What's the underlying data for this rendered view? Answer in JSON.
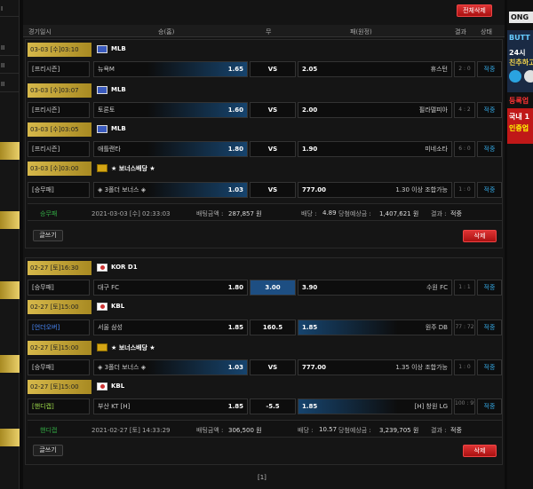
{
  "left_nav": [
    "I",
    "II",
    "II",
    "II"
  ],
  "right_ad": {
    "logo": "ONG",
    "button": "BUTT",
    "text1": "24시",
    "text2": "친추하고",
    "register": "등록업",
    "red1": "국내 1",
    "red2": "인증업"
  },
  "header": {
    "delete_all": "전체삭제",
    "cols": {
      "datetime": "경기일시",
      "home": "승(홈)",
      "draw": "무",
      "away": "패(원정)",
      "result": "결과",
      "status": "상태"
    }
  },
  "bet_groups": [
    {
      "matches": [
        {
          "date": "03-03 [수]03:10",
          "league": "MLB",
          "flag": "us",
          "type": "[프리시즌]",
          "home": "뉴욕M",
          "home_odds": "1.65",
          "mid": "VS",
          "away_odds": "2.05",
          "away": "휴스턴",
          "score": "2 : 0",
          "status": "적중",
          "sel": "home"
        },
        {
          "date": "03-03 [수]03:07",
          "league": "MLB",
          "flag": "us",
          "type": "[프리시즌]",
          "home": "토론토",
          "home_odds": "1.60",
          "mid": "VS",
          "away_odds": "2.00",
          "away": "필라델피아",
          "score": "4 : 2",
          "status": "적중",
          "sel": "home"
        },
        {
          "date": "03-03 [수]03:05",
          "league": "MLB",
          "flag": "us",
          "type": "[프리시즌]",
          "home": "애틀랜타",
          "home_odds": "1.80",
          "mid": "VS",
          "away_odds": "1.90",
          "away": "미네소타",
          "score": "6 : 0",
          "status": "적중",
          "sel": "home"
        },
        {
          "date": "03-03 [수]03:00",
          "league": "★ 보너스배당 ★",
          "flag": "bonus",
          "type": "[승무패]",
          "home": "◈ 3폴더 보너스 ◈",
          "home_odds": "1.03",
          "mid": "VS",
          "away_odds": "777.00",
          "away": "1.30 이상 조합가능",
          "score": "1 : 0",
          "status": "적중",
          "sel": "home"
        }
      ],
      "summary": {
        "bet_type": "승무패",
        "datetime": "2021-03-03 [수] 02:33:03",
        "bet_amount_label": "배팅금액 :",
        "bet_amount": "287,857 원",
        "odds_label": "배당 :",
        "odds": "4.89",
        "expected_label": "당첨예상금 :",
        "expected": "1,407,621 원",
        "result_label": "결과 :",
        "result": "적중"
      },
      "write_label": "글쓰기",
      "delete_label": "삭제"
    },
    {
      "matches": [
        {
          "date": "02-27 [토]16:30",
          "league": "KOR D1",
          "flag": "kr",
          "type": "[승무패]",
          "home": "대구 FC",
          "home_odds": "1.80",
          "mid": "3.00",
          "away_odds": "3.90",
          "away": "수원 FC",
          "score": "1 : 1",
          "status": "적중",
          "sel": "mid"
        },
        {
          "date": "02-27 [토]15:00",
          "league": "KBL",
          "flag": "kr",
          "type": "[언더오버]",
          "home": "서울 삼성",
          "home_odds": "1.85",
          "mid": "160.5",
          "away_odds": "1.85",
          "away": "원주 DB",
          "score": "77 : 72",
          "status": "적중",
          "sel": "away"
        },
        {
          "date": "02-27 [토]15:00",
          "league": "★ 보너스배당 ★",
          "flag": "bonus",
          "type": "[승무패]",
          "home": "◈ 3폴더 보너스 ◈",
          "home_odds": "1.03",
          "mid": "VS",
          "away_odds": "777.00",
          "away": "1.35 이상 조합가능",
          "score": "1 : 0",
          "status": "적중",
          "sel": "home"
        },
        {
          "date": "02-27 [토]15:00",
          "league": "KBL",
          "flag": "kr",
          "type": "[핸디캡]",
          "home": "부산 KT [H]",
          "home_odds": "1.85",
          "mid": "-5.5",
          "away_odds": "1.85",
          "away": "[H] 창원 LG",
          "score": "100 : 95",
          "status": "적중",
          "sel": "away"
        }
      ],
      "summary": {
        "bet_type": "핸디캡",
        "datetime": "2021-02-27 [토] 14:33:29",
        "bet_amount_label": "배팅금액 :",
        "bet_amount": "306,500 원",
        "odds_label": "배당 :",
        "odds": "10.57",
        "expected_label": "당첨예상금 :",
        "expected": "3,239,705 원",
        "result_label": "결과 :",
        "result": "적중"
      },
      "write_label": "글쓰기",
      "delete_label": "삭제"
    }
  ],
  "pagination": "[1]"
}
